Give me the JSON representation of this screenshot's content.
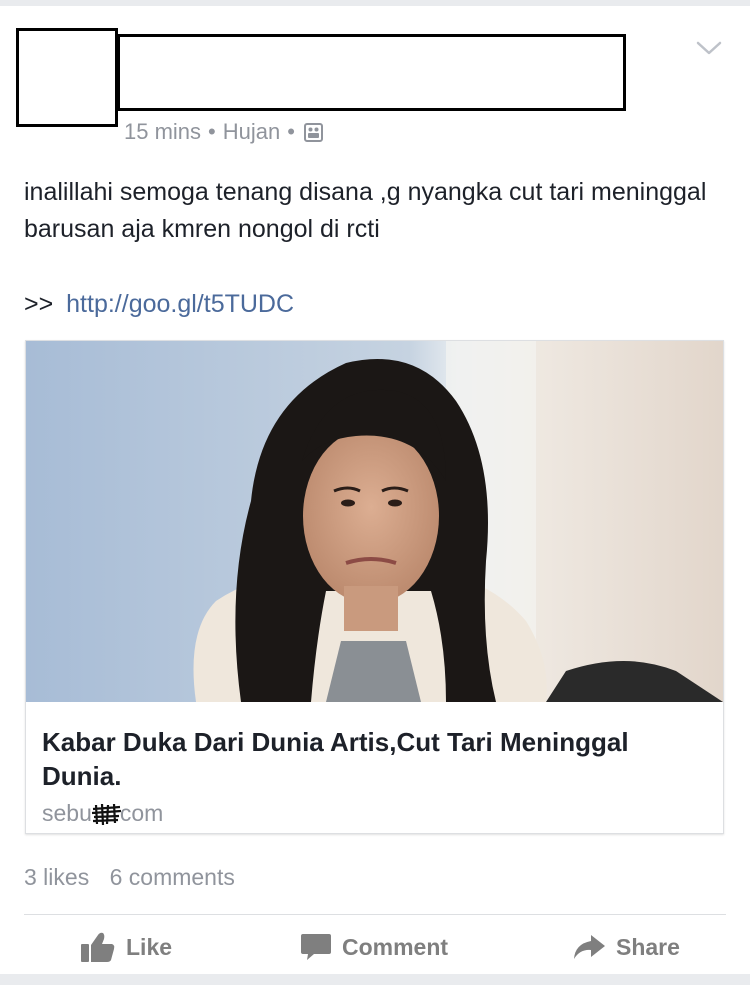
{
  "post": {
    "time": "15 mins",
    "location": "Hujan",
    "separator": "•",
    "text": "inalillahi semoga tenang disana ,g nyangka cut tari meninggal barusan aja kmren nongol di rcti",
    "link_prefix": ">>",
    "link_url": "http://goo.gl/t5TUDC",
    "icons": {
      "menu": "chevron-down-icon",
      "privacy": "photo-album-icon"
    }
  },
  "link_preview": {
    "title": "Kabar Duka Dari Dunia Artis,Cut Tari Meninggal Dunia.",
    "domain_start": "sebu",
    "domain_end": "com",
    "image": "woman-portrait-photo"
  },
  "stats": {
    "likes": "3 likes",
    "comments": "6 comments"
  },
  "actions": {
    "like": "Like",
    "comment": "Comment",
    "share": "Share"
  },
  "colors": {
    "link": "#4b6a9b",
    "meta": "#90949c",
    "action": "#7f7f7f",
    "text": "#1d2129"
  }
}
